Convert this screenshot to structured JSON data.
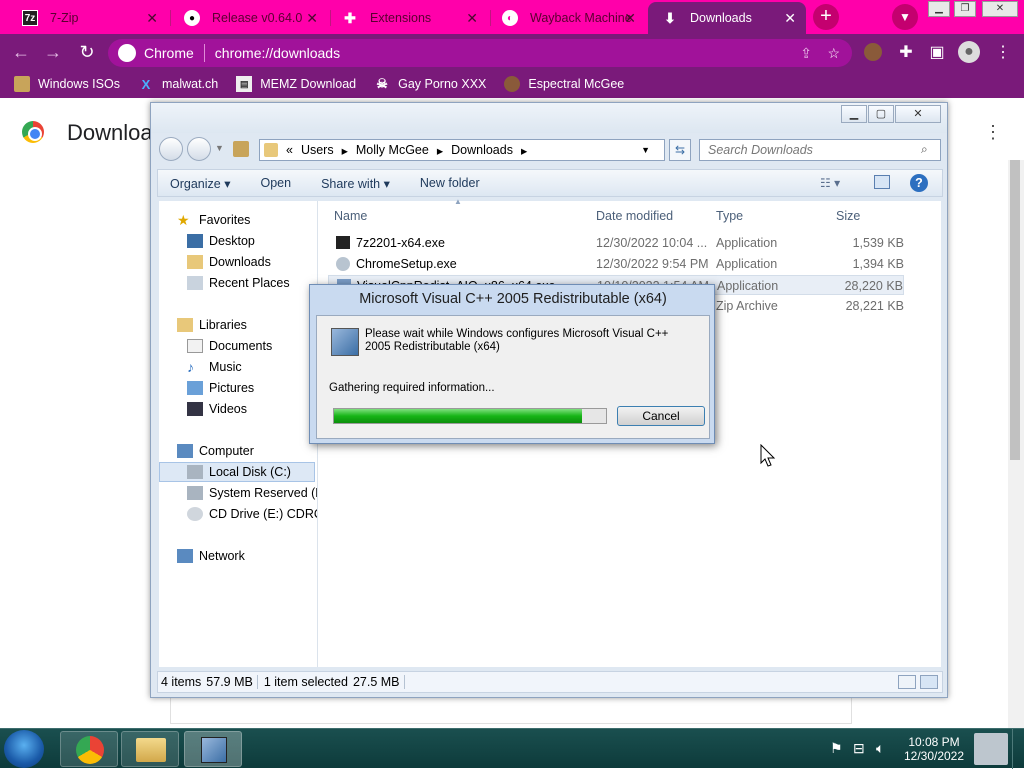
{
  "browser": {
    "tabs": [
      {
        "title": "7-Zip",
        "icon": "7zip-icon"
      },
      {
        "title": "Release v0.64.0",
        "icon": "github-icon"
      },
      {
        "title": "Extensions",
        "icon": "puzzle-icon"
      },
      {
        "title": "Wayback Machine",
        "icon": "globe-icon"
      },
      {
        "title": "Downloads",
        "icon": "download-icon",
        "active": true
      }
    ],
    "new_tab": "+",
    "omnibox": {
      "site": "Chrome",
      "url": "chrome://downloads"
    },
    "bookmarks": [
      {
        "label": "Windows ISOs",
        "icon": "folder-icon"
      },
      {
        "label": "malwat.ch",
        "icon": "x-icon"
      },
      {
        "label": "MEMZ Download",
        "icon": "page-icon"
      },
      {
        "label": "Gay Porno XXX",
        "icon": "skull-icon"
      },
      {
        "label": "Espectral McGee",
        "icon": "avatar-icon"
      }
    ],
    "page_title": "Downloa",
    "theme_colors": {
      "tabstrip": "#ff00aa",
      "toolbar": "#7a1a7a"
    }
  },
  "explorer": {
    "breadcrumb": [
      "«",
      "Users",
      "Molly McGee",
      "Downloads"
    ],
    "search_placeholder": "Search Downloads",
    "commands": [
      "Organize ▾",
      "Open",
      "Share with ▾",
      "New folder"
    ],
    "nav": {
      "favorites": "Favorites",
      "desktop": "Desktop",
      "downloads": "Downloads",
      "recent": "Recent Places",
      "libraries": "Libraries",
      "documents": "Documents",
      "music": "Music",
      "pictures": "Pictures",
      "videos": "Videos",
      "computer": "Computer",
      "local_disk": "Local Disk (C:)",
      "system_reserved": "System Reserved (D:",
      "cd_drive": "CD Drive (E:) CDROM",
      "network": "Network"
    },
    "columns": {
      "name": "Name",
      "date": "Date modified",
      "type": "Type",
      "size": "Size"
    },
    "files": [
      {
        "name": "7z2201-x64.exe",
        "date": "12/30/2022 10:04 ...",
        "type": "Application",
        "size": "1,539 KB"
      },
      {
        "name": "ChromeSetup.exe",
        "date": "12/30/2022 9:54 PM",
        "type": "Application",
        "size": "1,394 KB"
      },
      {
        "name": "VisualCppRedist_AIO_x86_x64.exe",
        "date": "10/10/2022 1:54 AM",
        "type": "Application",
        "size": "28,220 KB"
      },
      {
        "name": "",
        "date": "",
        "type": "Zip Archive",
        "size": "28,221 KB"
      }
    ],
    "status": {
      "items": "4 items",
      "total": "57.9 MB",
      "selected": "1 item selected",
      "selected_size": "27.5 MB"
    }
  },
  "installer": {
    "title": "Microsoft Visual C++ 2005 Redistributable (x64)",
    "message": "Please wait while Windows configures Microsoft Visual C++ 2005 Redistributable (x64)",
    "status": "Gathering required information...",
    "progress": 0.91,
    "cancel": "Cancel"
  },
  "taskbar": {
    "time": "10:08 PM",
    "date": "12/30/2022"
  }
}
